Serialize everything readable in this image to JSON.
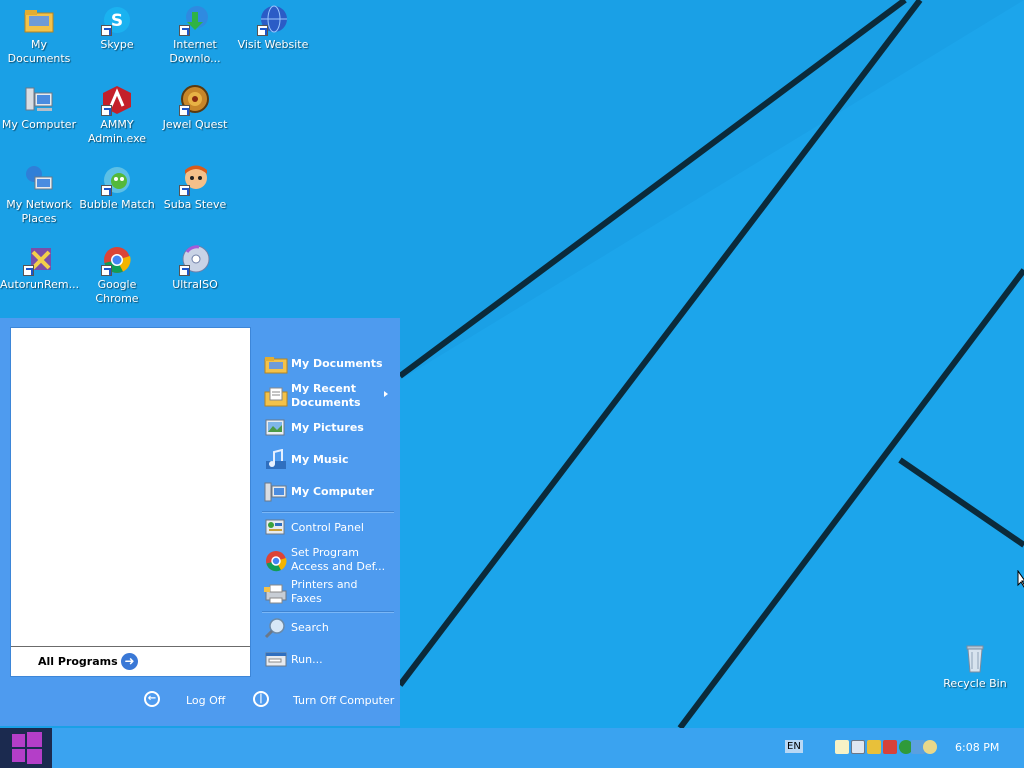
{
  "desktop": {
    "icons": [
      {
        "label": "My Documents",
        "icon": "folder-documents-icon"
      },
      {
        "label": "Skype",
        "icon": "skype-icon"
      },
      {
        "label": "Internet Downlo...",
        "icon": "internet-download-manager-icon"
      },
      {
        "label": "Visit Website",
        "icon": "globe-icon"
      },
      {
        "label": "My Computer",
        "icon": "computer-icon"
      },
      {
        "label": "AMMY Admin.exe",
        "icon": "ammy-admin-icon"
      },
      {
        "label": "Jewel Quest",
        "icon": "jewel-quest-icon"
      },
      {
        "label": "My Network Places",
        "icon": "network-places-icon"
      },
      {
        "label": "Bubble Match",
        "icon": "bubble-match-icon"
      },
      {
        "label": "Suba Steve",
        "icon": "suba-steve-icon"
      },
      {
        "label": "AutorunRem...",
        "icon": "autorun-remover-icon"
      },
      {
        "label": "Google Chrome",
        "icon": "chrome-icon"
      },
      {
        "label": "UltraISO",
        "icon": "ultraiso-icon"
      },
      {
        "label": "Recycle Bin",
        "icon": "recycle-bin-icon"
      }
    ]
  },
  "start_menu": {
    "all_programs": "All Programs",
    "items": [
      {
        "label": "My Documents",
        "icon": "folder-documents-icon"
      },
      {
        "label": "My Recent Documents",
        "icon": "recent-documents-icon"
      },
      {
        "label": "My Pictures",
        "icon": "pictures-icon"
      },
      {
        "label": "My Music",
        "icon": "music-icon"
      },
      {
        "label": "My Computer",
        "icon": "computer-icon"
      },
      {
        "label": "Control Panel",
        "icon": "control-panel-icon"
      },
      {
        "label": "Set Program Access and Def...",
        "icon": "program-access-icon"
      },
      {
        "label": "Printers and Faxes",
        "icon": "printer-icon"
      },
      {
        "label": "Search",
        "icon": "search-icon"
      },
      {
        "label": "Run...",
        "icon": "run-icon"
      }
    ],
    "log_off": "Log Off",
    "turn_off": "Turn Off Computer"
  },
  "taskbar": {
    "language": "EN",
    "clock": "6:08 PM"
  },
  "colors": {
    "desktop_bg": "#1ba1e6",
    "start_menu_bg": "#4e9bef",
    "taskbar_bg": "#3aa3f0",
    "start_button": "#1b2a4f",
    "windows_logo": "#b43ec8"
  }
}
